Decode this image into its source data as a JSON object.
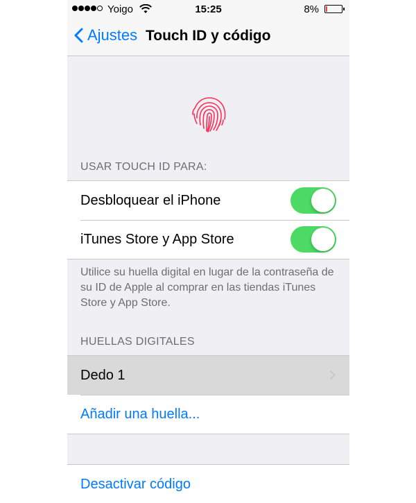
{
  "status_bar": {
    "carrier": "Yoigo",
    "time": "15:25",
    "battery_percent": "8%",
    "battery_level": 0.08,
    "signal_dots_filled": 4,
    "signal_dots_total": 5,
    "icons": [
      "signal-icon",
      "wifi-icon",
      "battery-icon"
    ]
  },
  "nav": {
    "back_label": "Ajustes",
    "title": "Touch ID y código"
  },
  "fingerprint": {
    "icon": "fingerprint-icon",
    "color": "#ff2d55"
  },
  "use_touch_id": {
    "header": "USAR TOUCH ID PARA:",
    "items": [
      {
        "label": "Desbloquear el iPhone",
        "enabled": true
      },
      {
        "label": "iTunes Store y App Store",
        "enabled": true
      }
    ],
    "footer": "Utilice su huella digital en lugar de la contraseña de su ID de Apple al comprar en las tiendas iTunes Store y App Store."
  },
  "fingerprints": {
    "header": "HUELLAS DIGITALES",
    "items": [
      {
        "label": "Dedo 1"
      }
    ],
    "add_label": "Añadir una huella..."
  },
  "passcode": {
    "disable_label": "Desactivar código"
  },
  "colors": {
    "accent": "#007aff",
    "toggle_on": "#4cd964",
    "background": "#efeff4",
    "battery_low": "#ff3b30"
  }
}
